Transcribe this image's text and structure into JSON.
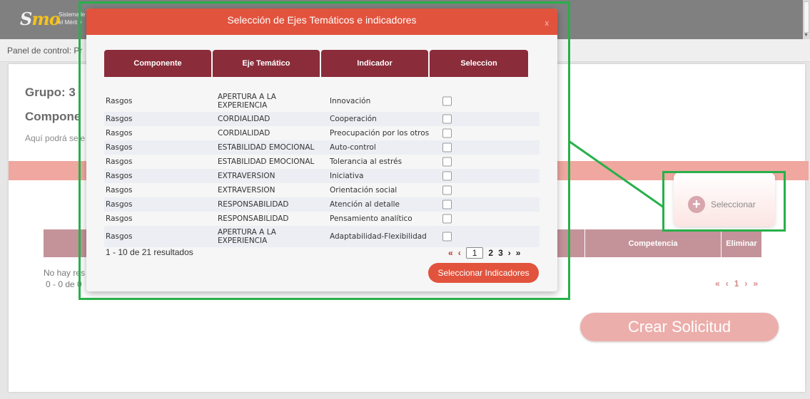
{
  "header": {
    "logo_mark_prefix": "S",
    "logo_mark_suffix": "mo",
    "logo_text_line1": "Sistema le",
    "logo_text_line2": "el Mérit y"
  },
  "breadcrumb": "Panel de control: Pr",
  "main": {
    "grupo_label": "Grupo: 3",
    "componente_label": "Compone",
    "hint": "Aquí podrá sele",
    "seleccionar_label": "Seleccionar",
    "table_headers": [
      "",
      "",
      "",
      "",
      "Competencia",
      "Eliminar"
    ],
    "no_results": "No hay res",
    "count": "0 - 0 de 0",
    "pager": {
      "first": "«",
      "prev": "‹",
      "page": "1",
      "next": "›",
      "last": "»"
    },
    "crear_label": "Crear Solicitud"
  },
  "modal": {
    "title": "Selección de Ejes Temáticos e indicadores",
    "close": "x",
    "headers": [
      "Componente",
      "Eje Temático",
      "Indicador",
      "Seleccion"
    ],
    "rows": [
      {
        "componente": "Rasgos",
        "eje": "APERTURA A LA EXPERIENCIA",
        "indicador": "Innovación"
      },
      {
        "componente": "Rasgos",
        "eje": "CORDIALIDAD",
        "indicador": "Cooperación"
      },
      {
        "componente": "Rasgos",
        "eje": "CORDIALIDAD",
        "indicador": "Preocupación por los otros"
      },
      {
        "componente": "Rasgos",
        "eje": "ESTABILIDAD EMOCIONAL",
        "indicador": "Auto-control"
      },
      {
        "componente": "Rasgos",
        "eje": "ESTABILIDAD EMOCIONAL",
        "indicador": "Tolerancia al estrés"
      },
      {
        "componente": "Rasgos",
        "eje": "EXTRAVERSION",
        "indicador": "Iniciativa"
      },
      {
        "componente": "Rasgos",
        "eje": "EXTRAVERSION",
        "indicador": "Orientación social"
      },
      {
        "componente": "Rasgos",
        "eje": "RESPONSABILIDAD",
        "indicador": "Atención al detalle"
      },
      {
        "componente": "Rasgos",
        "eje": "RESPONSABILIDAD",
        "indicador": "Pensamiento analítico"
      },
      {
        "componente": "Rasgos",
        "eje": "APERTURA A LA EXPERIENCIA",
        "indicador": "Adaptabilidad-Flexibilidad"
      }
    ],
    "results_text": "1 - 10 de 21 resultados",
    "pager": {
      "first": "«",
      "prev": "‹",
      "current": "1",
      "p2": "2",
      "p3": "3",
      "next": "›",
      "last": "»"
    },
    "select_button": "Seleccionar Indicadores"
  },
  "colors": {
    "modal_header": "#e2533d",
    "table_header": "#8a2c3a",
    "annotation": "#28b04a"
  }
}
